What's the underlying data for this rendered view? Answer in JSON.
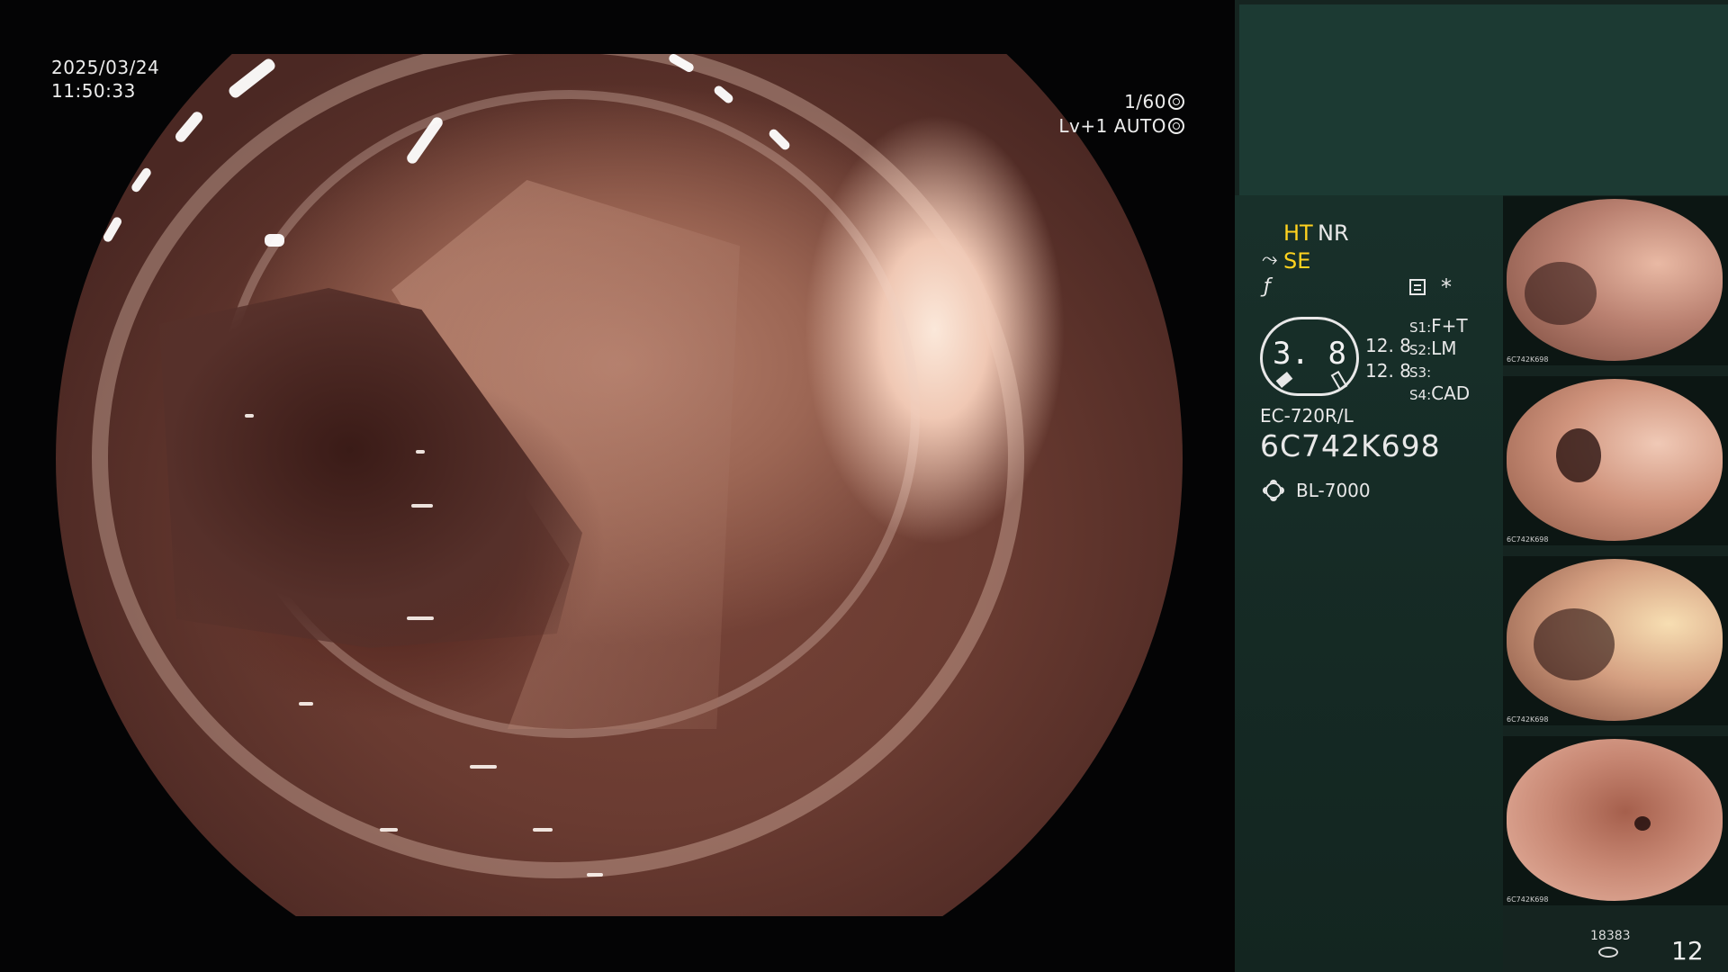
{
  "overlay": {
    "date": "2025/03/24",
    "time": "11:50:33",
    "shutter": "1/60",
    "level": "Lv+1 AUTO"
  },
  "panel": {
    "modes": {
      "ht": "HT",
      "nr": "NR",
      "se": "SE"
    },
    "asterisk": "*",
    "gauge_value": "3. 8",
    "readings": [
      "12. 8",
      "12. 8"
    ],
    "slots": [
      {
        "key": "S1:",
        "value": "F+T"
      },
      {
        "key": "S2:",
        "value": "LM"
      },
      {
        "key": "S3:",
        "value": ""
      },
      {
        "key": "S4:",
        "value": "CAD"
      }
    ],
    "scope_model": "EC-720R/L",
    "serial": "6C742K698",
    "light_source": "BL-7000",
    "accent_color": "#ffd21f",
    "icons": [
      "scope-angle-icon",
      "freeze-icon",
      "menu-icon",
      "light-source-icon",
      "storage-icon"
    ]
  },
  "thumbnails": [
    {
      "id": "6C742K698"
    },
    {
      "id": "6C742K698"
    },
    {
      "id": "6C742K698"
    },
    {
      "id": "6C742K698"
    }
  ],
  "counter": {
    "total": "18383",
    "count": "12"
  }
}
